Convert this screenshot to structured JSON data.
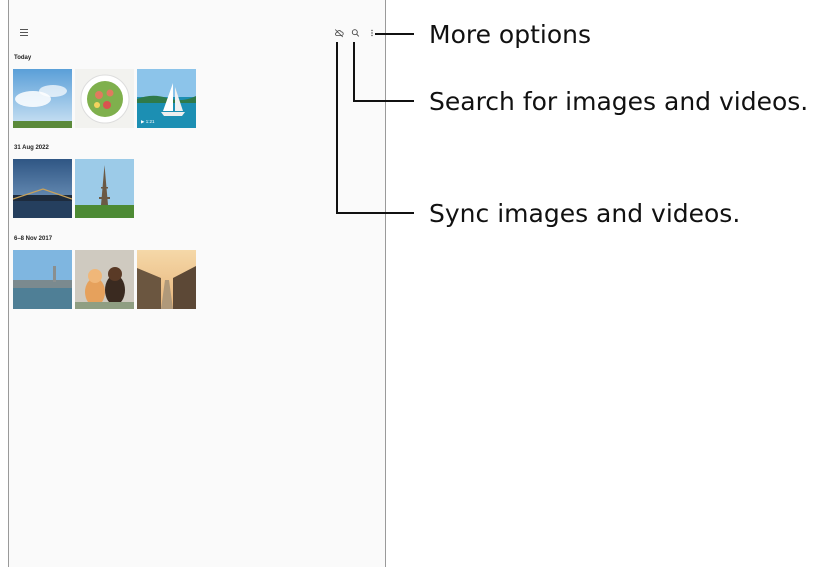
{
  "toolbar": {
    "menu_icon": "hamburger-menu-icon",
    "sync_icon": "cloud-off-icon",
    "search_icon": "search-icon",
    "more_icon": "more-vertical-icon"
  },
  "sections": [
    {
      "label": "Today",
      "items": [
        {
          "type": "image",
          "subject": "sky with clouds"
        },
        {
          "type": "image",
          "subject": "salad bowl"
        },
        {
          "type": "video",
          "subject": "sailboat on sea",
          "duration": "1:21"
        }
      ]
    },
    {
      "label": "31 Aug 2022",
      "items": [
        {
          "type": "image",
          "subject": "city bridge at dusk"
        },
        {
          "type": "image",
          "subject": "eiffel tower"
        }
      ]
    },
    {
      "label": "6–8 Nov 2017",
      "items": [
        {
          "type": "image",
          "subject": "river city view"
        },
        {
          "type": "image",
          "subject": "cat and dog"
        },
        {
          "type": "image",
          "subject": "village street at sunset"
        }
      ]
    }
  ],
  "callouts": {
    "more_options": "More options",
    "search": "Search for images and videos.",
    "sync": "Sync images and videos."
  },
  "colors": {
    "leader_line": "#111111",
    "frame": "#9a9a9a"
  }
}
